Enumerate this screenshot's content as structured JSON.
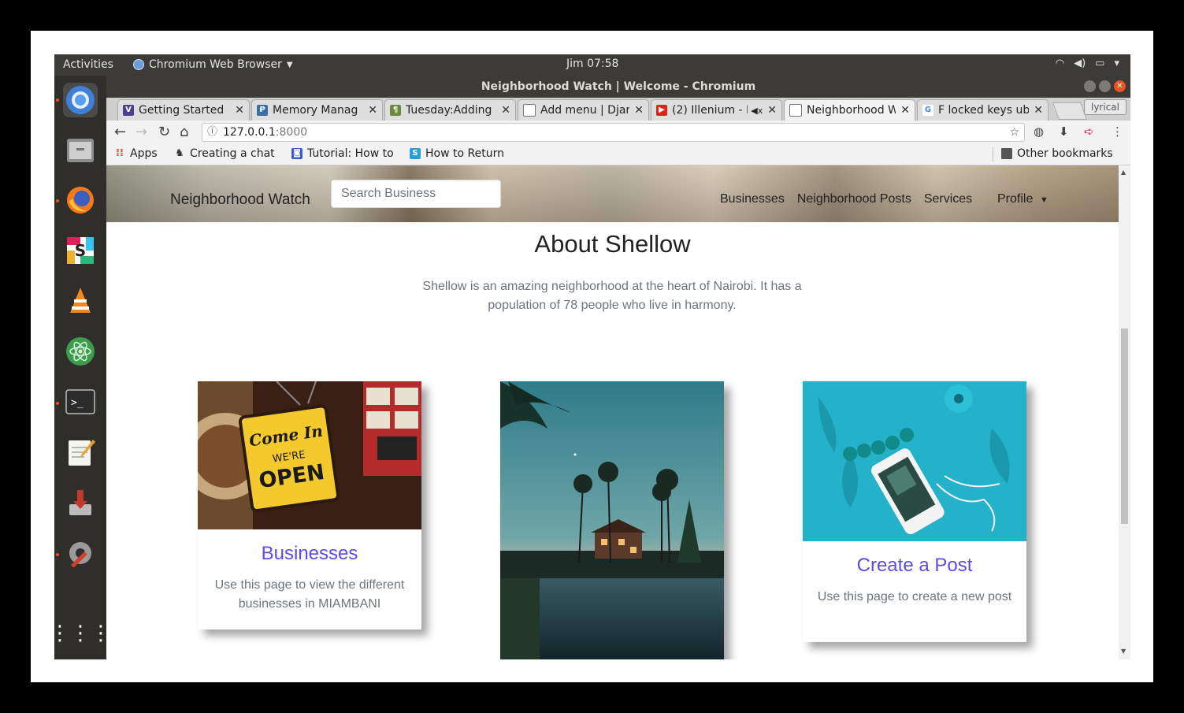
{
  "os": {
    "activities": "Activities",
    "app_name": "Chromium Web Browser",
    "clock": "Jim 07:58"
  },
  "browser": {
    "window_title": "Neighborhood Watch | Welcome - Chromium",
    "tabs": [
      {
        "label": "Getting Started",
        "favicon": "V",
        "color": "#4b3f8f"
      },
      {
        "label": "Memory Manag",
        "favicon": "py",
        "color": "#3b6fa8"
      },
      {
        "label": "Tuesday:Adding",
        "favicon": "pin",
        "color": "#6a8a3a"
      },
      {
        "label": "Add menu | Djar",
        "favicon": "doc",
        "color": "#777777"
      },
      {
        "label": "(2) Illenium - F",
        "favicon": "yt",
        "color": "#e62117"
      },
      {
        "label": "Neighborhood W",
        "favicon": "doc",
        "color": "#777777"
      },
      {
        "label": "F locked keys ub",
        "favicon": "G",
        "color": "#4285f4"
      }
    ],
    "profile_chip": "lyrical",
    "url_host": "127.0.0.1",
    "url_port": ":8000",
    "bookmarks": [
      {
        "label": "Apps",
        "icon": "apps-grid-icon"
      },
      {
        "label": "Creating a chat",
        "icon": "ghost-icon"
      },
      {
        "label": "Tutorial: How to",
        "icon": "discord-icon"
      },
      {
        "label": "How to Return",
        "icon": "s-icon"
      }
    ],
    "other_bookmarks": "Other bookmarks"
  },
  "page": {
    "brand": "Neighborhood Watch",
    "search_placeholder": "Search Business",
    "nav": [
      "Businesses",
      "Neighborhood Posts",
      "Services"
    ],
    "profile": "Profile",
    "about_title": "About Shellow",
    "about_text": "Shellow is an amazing neighborhood at the heart of Nairobi. It has a population of 78 people who live in harmony.",
    "cards": [
      {
        "title": "Businesses",
        "text": "Use this page to view the different businesses in MIAMBANI",
        "sign_line1": "Come In",
        "sign_line2": "WE'RE",
        "sign_line3": "OPEN"
      },
      {
        "title": "",
        "text": ""
      },
      {
        "title": "Create a Post",
        "text": "Use this page to create a new post"
      }
    ]
  }
}
